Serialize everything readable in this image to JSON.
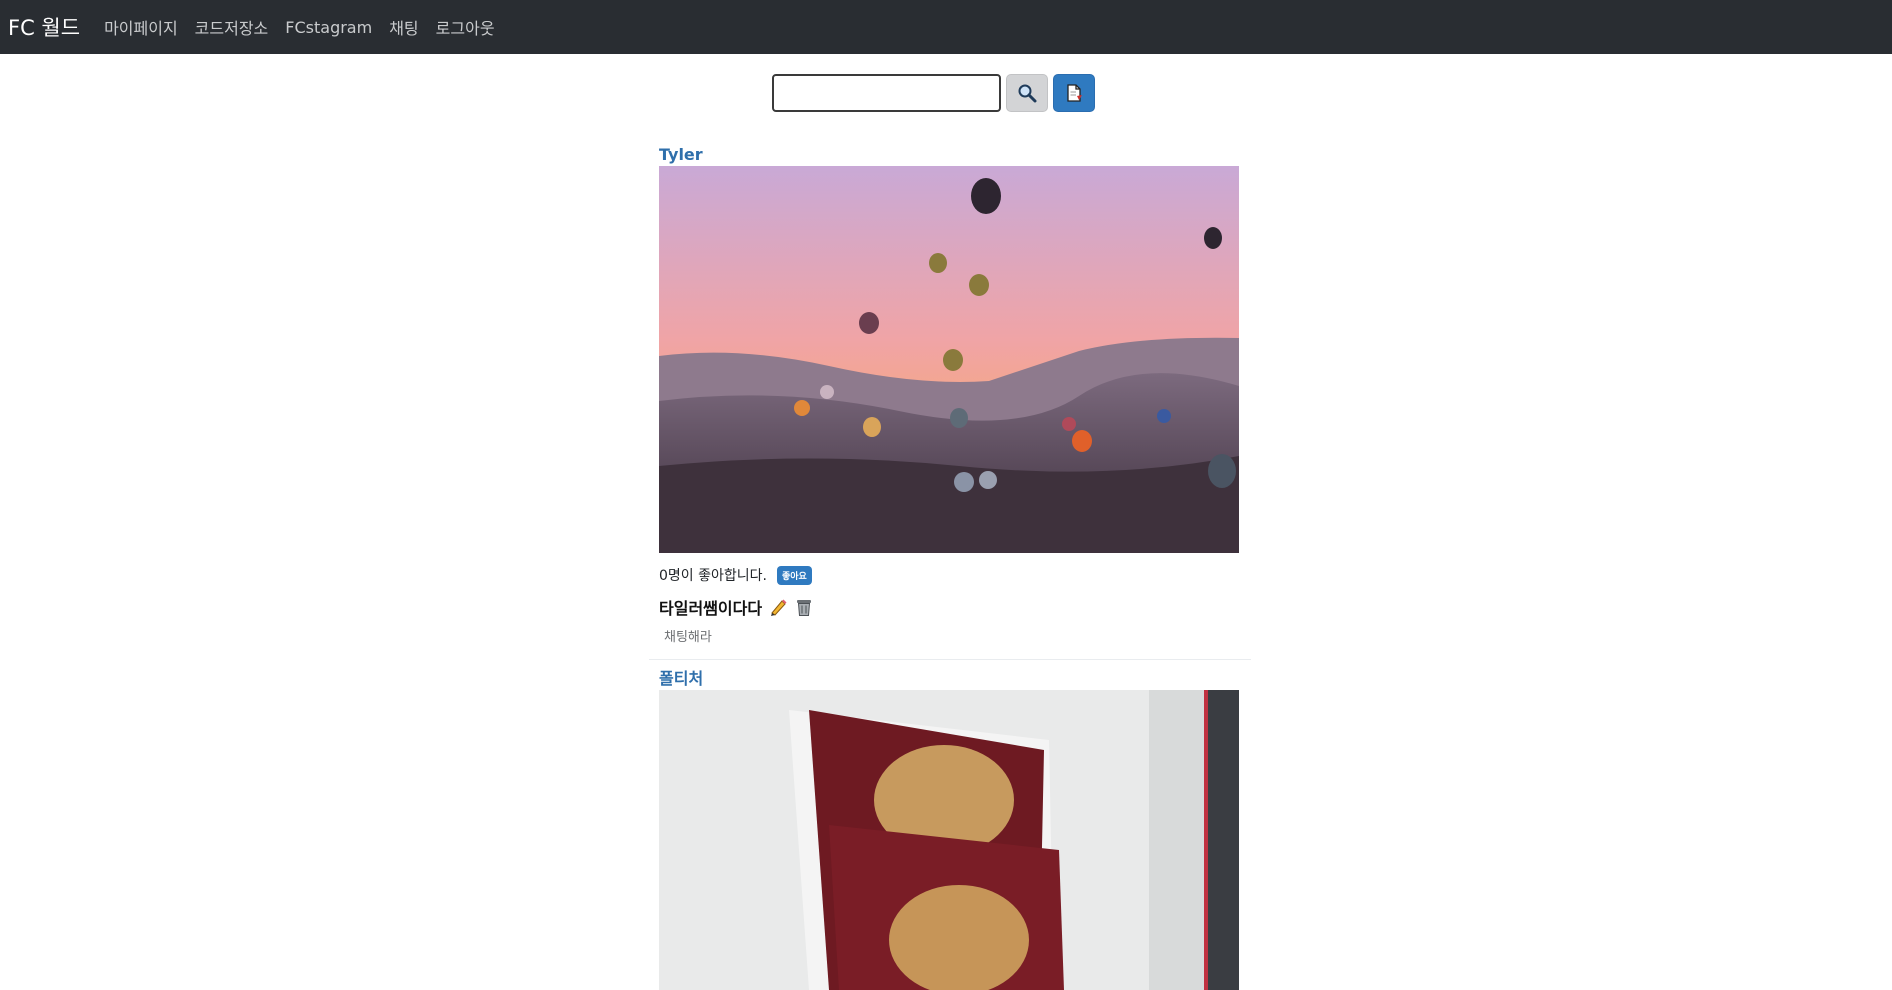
{
  "navbar": {
    "brand": "FC 월드",
    "links": [
      "마이페이지",
      "코드저장소",
      "FCstagram",
      "채팅",
      "로그아웃"
    ]
  },
  "search": {
    "value": "",
    "placeholder": "",
    "search_icon": "magnifier-icon",
    "write_icon": "write-document-icon"
  },
  "posts": [
    {
      "author": "Tyler",
      "image": "hot-air-balloons-over-valley-at-sunset",
      "likes_text": "0명이 좋아합니다.",
      "like_label": "좋아요",
      "title": "타일러쌤이다다",
      "body": "채팅해라"
    },
    {
      "author": "폴티처",
      "image": "cookies-in-red-wrappers"
    }
  ],
  "colors": {
    "navbar_bg": "#292d32",
    "accent": "#2f7ac0",
    "author_link": "#2f6fab"
  }
}
